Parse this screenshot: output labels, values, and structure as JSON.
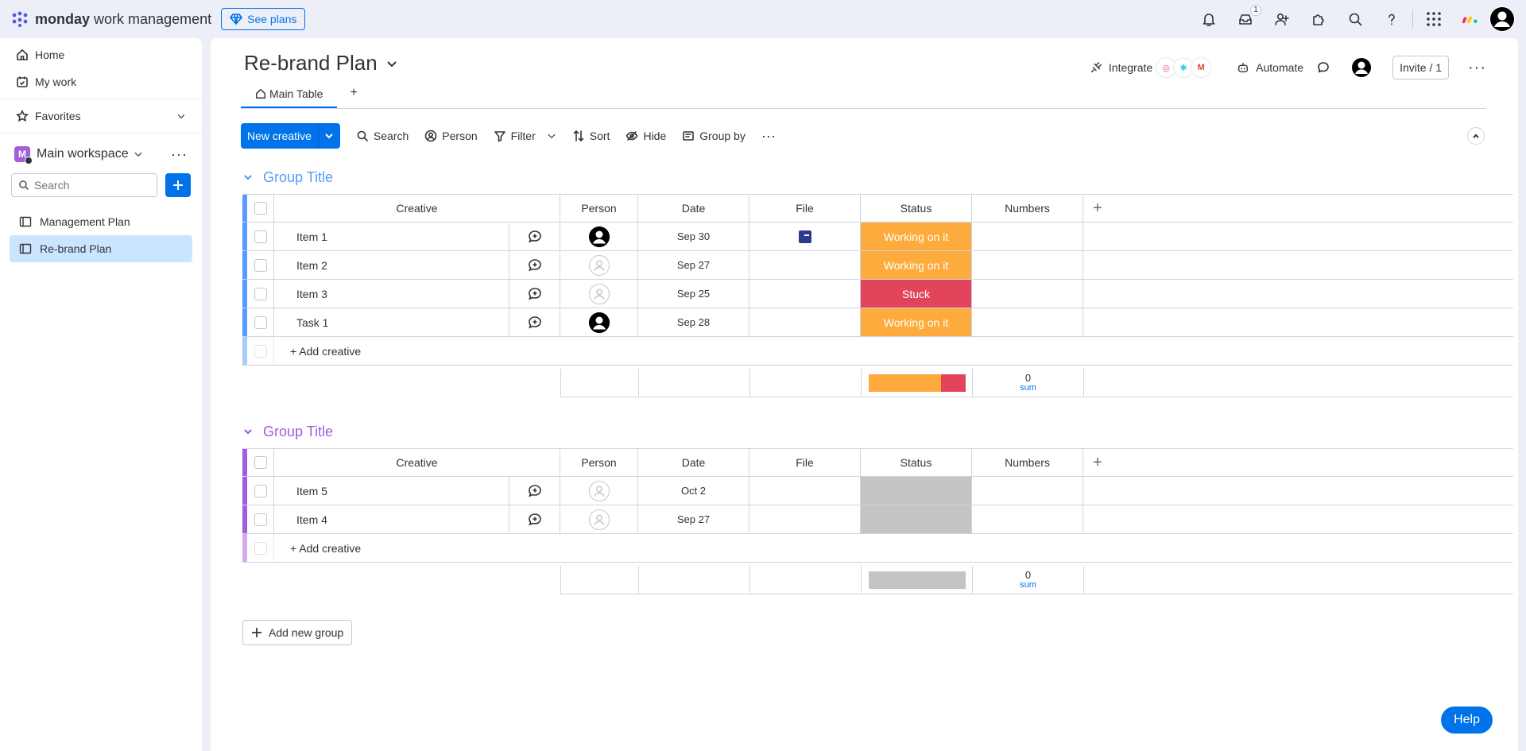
{
  "brand": {
    "name_bold": "monday",
    "name_rest": "work management"
  },
  "top": {
    "see_plans": "See plans",
    "inbox_badge": "1"
  },
  "sidebar": {
    "home": "Home",
    "my_work": "My work",
    "favorites": "Favorites",
    "workspace_initial": "M",
    "workspace_name": "Main workspace",
    "search_placeholder": "Search",
    "boards": [
      {
        "label": "Management Plan"
      },
      {
        "label": "Re-brand Plan"
      }
    ]
  },
  "board": {
    "title": "Re-brand Plan",
    "tab_main": "Main Table",
    "tab_add": "+",
    "integrate": "Integrate",
    "automate": "Automate",
    "invite": "Invite / 1"
  },
  "toolbar": {
    "new_item": "New creative",
    "search": "Search",
    "person": "Person",
    "filter": "Filter",
    "sort": "Sort",
    "hide": "Hide",
    "group_by": "Group by"
  },
  "columns": {
    "name": "Creative",
    "person": "Person",
    "date": "Date",
    "file": "File",
    "status": "Status",
    "numbers": "Numbers",
    "add": "+"
  },
  "status_colors": {
    "working": "#fdab3d",
    "stuck": "#e2445c",
    "empty": "#c4c4c4"
  },
  "groups": [
    {
      "title": "Group Title",
      "color": "#579bfc",
      "items": [
        {
          "name": "Item 1",
          "person": "filled",
          "date": "Sep 30",
          "file": true,
          "status": "Working on it",
          "status_key": "working"
        },
        {
          "name": "Item 2",
          "person": "empty",
          "date": "Sep 27",
          "file": false,
          "status": "Working on it",
          "status_key": "working"
        },
        {
          "name": "Item 3",
          "person": "empty",
          "date": "Sep 25",
          "file": false,
          "status": "Stuck",
          "status_key": "stuck"
        },
        {
          "name": "Task 1",
          "person": "filled",
          "date": "Sep 28",
          "file": false,
          "status": "Working on it",
          "status_key": "working"
        }
      ],
      "add_label": "+ Add creative",
      "status_summary": [
        {
          "key": "working",
          "fraction": 0.75
        },
        {
          "key": "stuck",
          "fraction": 0.25
        }
      ],
      "sum_value": "0",
      "sum_label": "sum"
    },
    {
      "title": "Group Title",
      "color": "#a25ddc",
      "items": [
        {
          "name": "Item 5",
          "person": "empty",
          "date": "Oct 2",
          "file": false,
          "status": "",
          "status_key": "empty"
        },
        {
          "name": "Item 4",
          "person": "empty",
          "date": "Sep 27",
          "file": false,
          "status": "",
          "status_key": "empty"
        }
      ],
      "add_label": "+ Add creative",
      "status_summary": [
        {
          "key": "empty",
          "fraction": 1
        }
      ],
      "sum_value": "0",
      "sum_label": "sum"
    }
  ],
  "add_group": "Add new group",
  "help": "Help"
}
